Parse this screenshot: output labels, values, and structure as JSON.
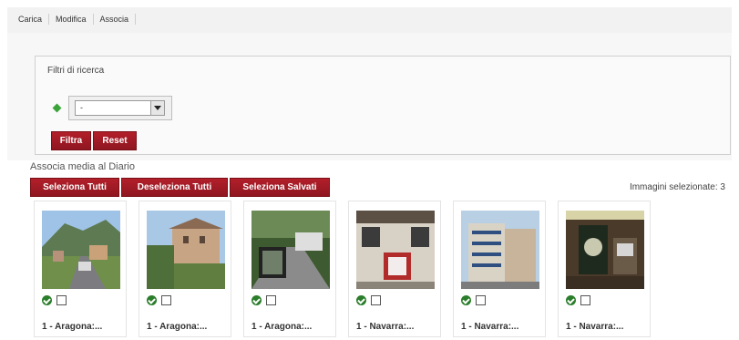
{
  "tabs": [
    "Carica",
    "Modifica",
    "Associa"
  ],
  "filter": {
    "title": "Filtri di ricerca",
    "select_value": "-",
    "filtra_label": "Filtra",
    "reset_label": "Reset"
  },
  "media": {
    "title": "Associa media al Diario",
    "select_all_label": "Seleziona Tutti",
    "deselect_all_label": "Deseleziona Tutti",
    "select_saved_label": "Seleziona Salvati",
    "selected_count_text": "Immagini selezionate: 3",
    "items": [
      {
        "caption": "1 - Aragona:..."
      },
      {
        "caption": "1 - Aragona:..."
      },
      {
        "caption": "1 - Aragona:..."
      },
      {
        "caption": "1 - Navarra:..."
      },
      {
        "caption": "1 - Navarra:..."
      },
      {
        "caption": "1 - Navarra:..."
      }
    ]
  },
  "colors": {
    "button_red": "#a01a24",
    "ok_green": "#2a7d2a",
    "diamond_green": "#3aa43a"
  }
}
